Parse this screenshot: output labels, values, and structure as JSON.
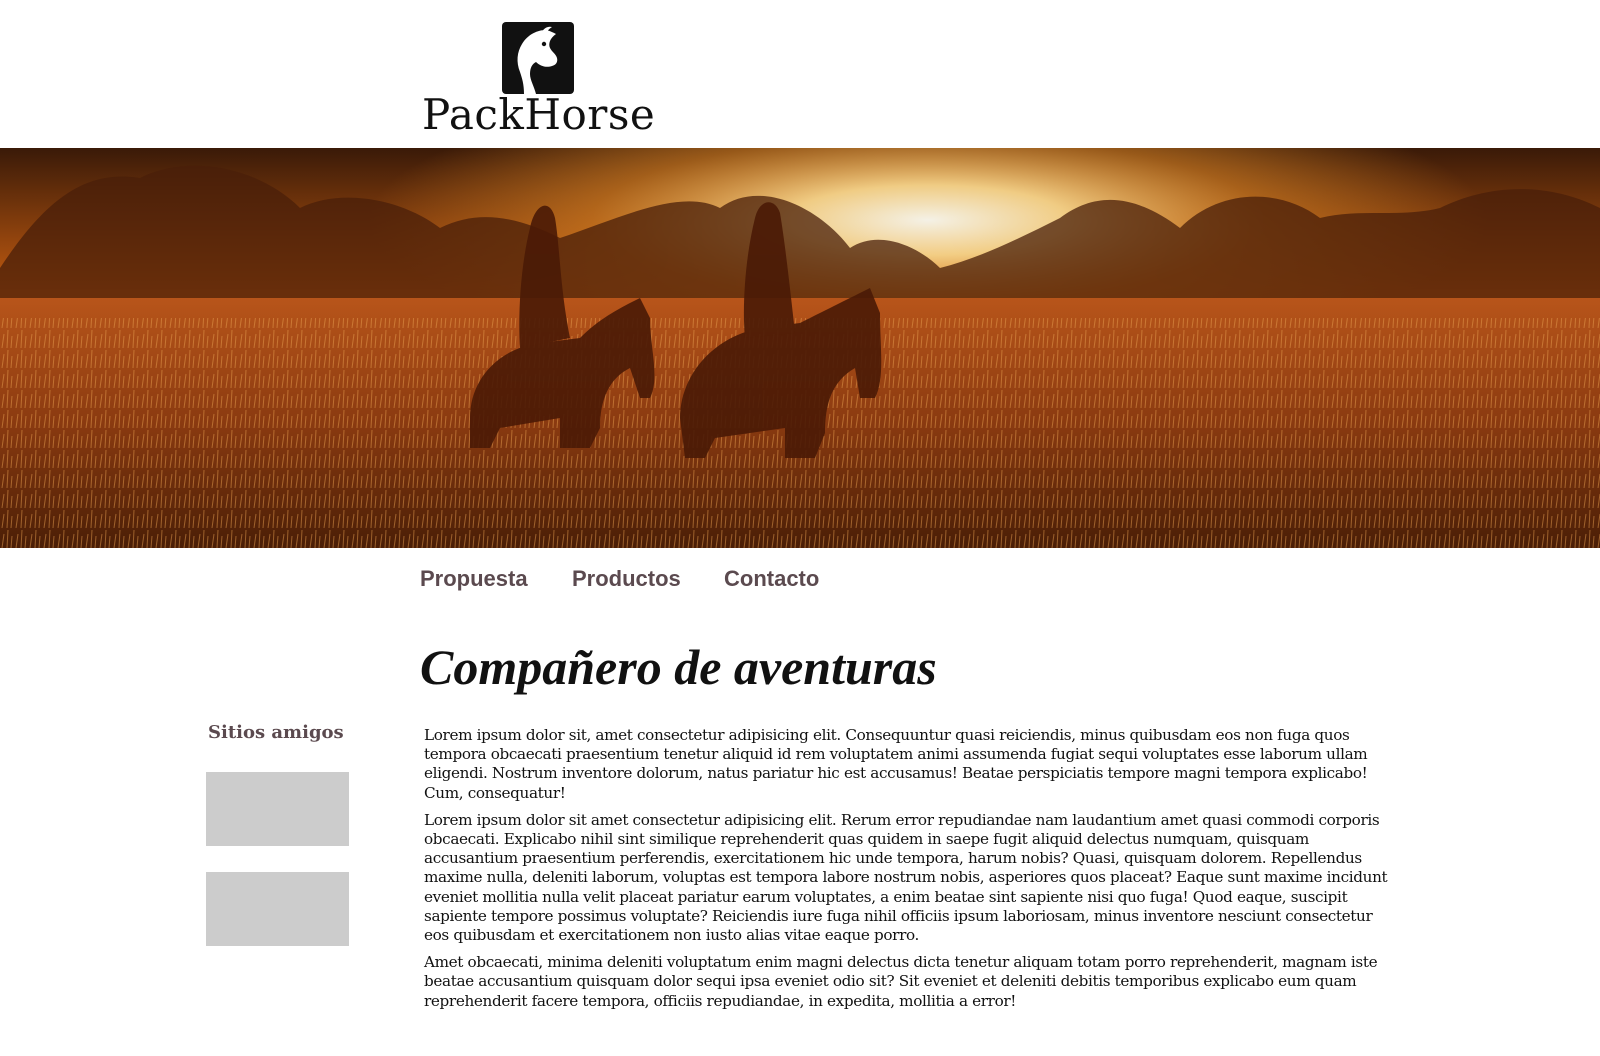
{
  "brand": {
    "name": "PackHorse",
    "logo_icon": "horse-head-icon",
    "colors": {
      "nav_text": "#5b4a4f",
      "placeholder": "#cccccc",
      "logo": "#111111"
    }
  },
  "hero": {
    "image": "sunset-horse-riders-photo"
  },
  "nav": {
    "items": [
      {
        "label": "Propuesta"
      },
      {
        "label": "Productos"
      },
      {
        "label": "Contacto"
      }
    ]
  },
  "main": {
    "title": "Compañero de aventuras",
    "paragraphs": [
      "Lorem ipsum dolor sit, amet consectetur adipisicing elit. Consequuntur quasi reiciendis, minus quibusdam eos non fuga quos tempora obcaecati praesentium tenetur aliquid id rem voluptatem animi assumenda fugiat sequi voluptates esse laborum ullam eligendi. Nostrum inventore dolorum, natus pariatur hic est accusamus! Beatae perspiciatis tempore magni tempora explicabo! Cum, consequatur!",
      "Lorem ipsum dolor sit amet consectetur adipisicing elit. Rerum error repudiandae nam laudantium amet quasi commodi corporis obcaecati. Explicabo nihil sint similique reprehenderit quas quidem in saepe fugit aliquid delectus numquam, quisquam accusantium praesentium perferendis, exercitationem hic unde tempora, harum nobis? Quasi, quisquam dolorem. Repellendus maxime nulla, deleniti laborum, voluptas est tempora labore nostrum nobis, asperiores quos placeat? Eaque sunt maxime incidunt eveniet mollitia nulla velit placeat pariatur earum voluptates, a enim beatae sint sapiente nisi quo fuga! Quod eaque, suscipit sapiente tempore possimus voluptate? Reiciendis iure fuga nihil officiis ipsum laboriosam, minus inventore nesciunt consectetur eos quibusdam et exercitationem non iusto alias vitae eaque porro.",
      "Amet obcaecati, minima deleniti voluptatum enim magni delectus dicta tenetur aliquam totam porro reprehenderit, magnam iste beatae accusantium quisquam dolor sequi ipsa eveniet odio sit? Sit eveniet et deleniti debitis temporibus explicabo eum quam reprehenderit facere tempora, officiis repudiandae, in expedita, mollitia a error!"
    ]
  },
  "sidebar": {
    "title": "Sitios amigos"
  }
}
